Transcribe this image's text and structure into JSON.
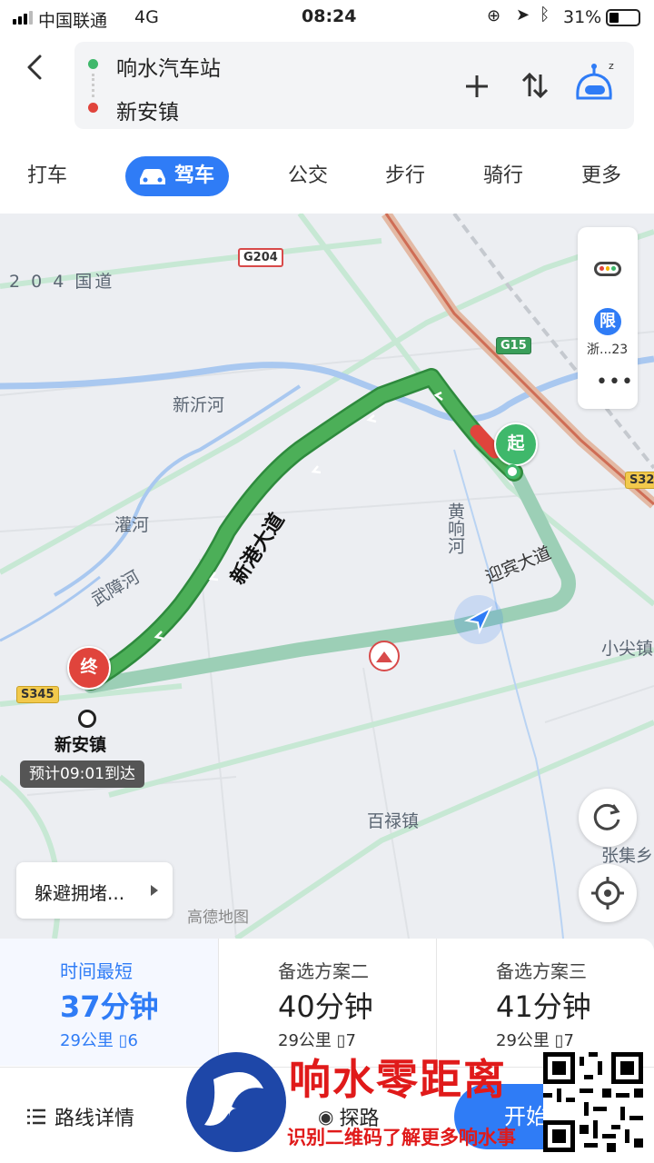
{
  "status_bar": {
    "carrier": "中国联通",
    "network": "4G",
    "time": "08:24",
    "battery": "31%"
  },
  "header": {
    "origin": "响水汽车站",
    "destination": "新安镇",
    "colors": {
      "origin_dot": "#3fb86b",
      "destination_dot": "#e0443c"
    }
  },
  "modes": [
    {
      "label": "打车"
    },
    {
      "label": "驾车",
      "active": true
    },
    {
      "label": "公交"
    },
    {
      "label": "步行"
    },
    {
      "label": "骑行"
    },
    {
      "label": "更多"
    }
  ],
  "map": {
    "labels": {
      "g204_road": "2 0 4 国道",
      "xinyi_river": "新沂河",
      "guan_river": "灌河",
      "wuzhang_river": "武障河",
      "huangxiang_river": "黄响河",
      "yingbin_road": "迎宾大道",
      "xingang_road": "新港大道",
      "xiaojian": "小尖镇",
      "bailu": "百禄镇",
      "zhangji": "张集乡",
      "destination_town": "新安镇",
      "brand": "高德地图"
    },
    "shields": {
      "g204": "G204",
      "g15": "G15",
      "s345": "S345",
      "s32x": "S32"
    },
    "start_marker": "起",
    "end_marker": "终",
    "eta": "预计09:01到达",
    "avoid_button": "躲避拥堵...",
    "side_panel": {
      "limit_badge": "限",
      "plate": "浙...23"
    },
    "route_color": "#4caf58",
    "alt_route_color": "#9ccfb6"
  },
  "route_options": [
    {
      "label": "时间最短",
      "time": "37分钟",
      "distance": "29公里",
      "lights": "6",
      "selected": true
    },
    {
      "label": "备选方案二",
      "time": "40分钟",
      "distance": "29公里",
      "lights": "7"
    },
    {
      "label": "备选方案三",
      "time": "41分钟",
      "distance": "29公里",
      "lights": "7"
    }
  ],
  "actions": {
    "details": "路线详情",
    "explore": "探路",
    "start": "开始导航"
  },
  "watermark": {
    "title": "响水零距离",
    "subtitle": "识别二维码了解更多响水事"
  }
}
